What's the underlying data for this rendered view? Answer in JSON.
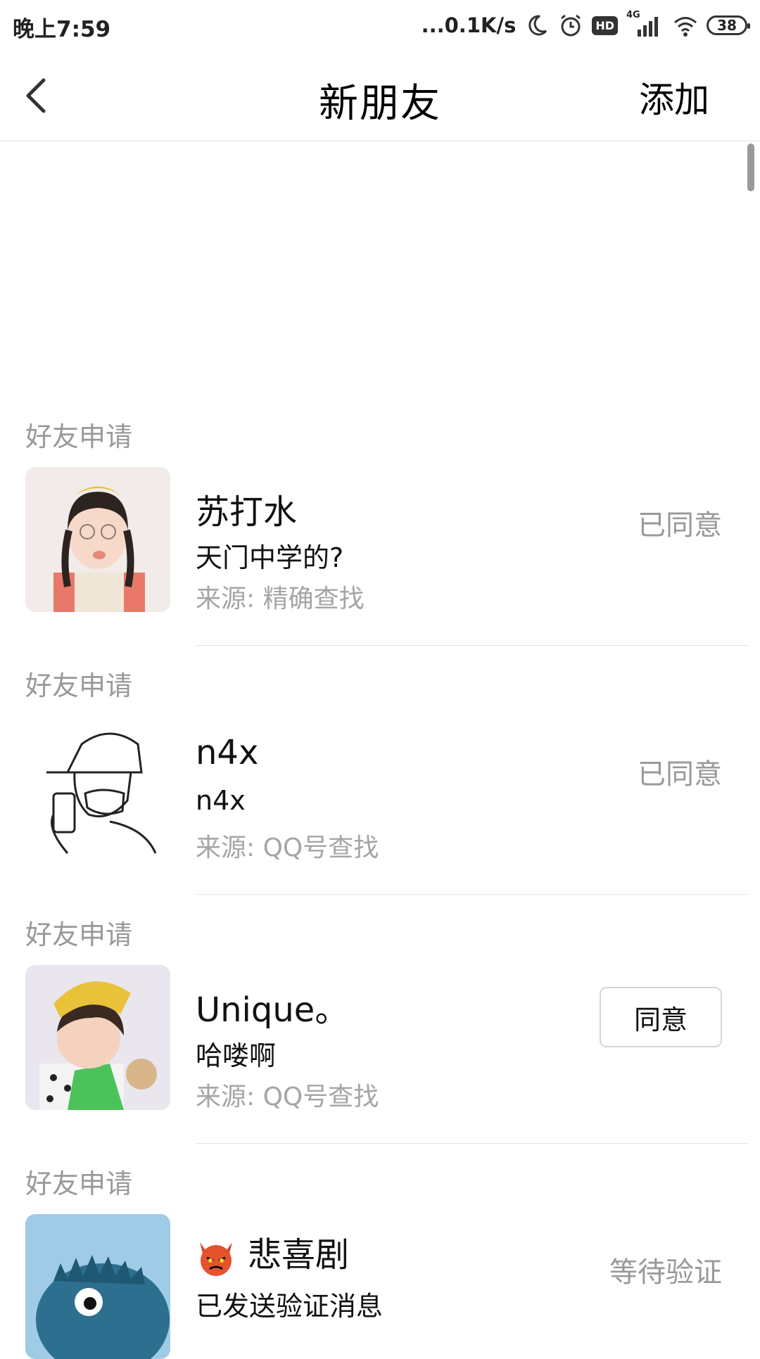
{
  "status_bar": {
    "time": "晚上7:59",
    "net_speed": "...0.1K/s",
    "hd": "HD",
    "network": "4G",
    "battery": "38"
  },
  "nav": {
    "title": "新朋友",
    "add_label": "添加"
  },
  "requests": [
    {
      "section": "好友申请",
      "name": "苏打水",
      "message": "天门中学的?",
      "source": "来源: 精确查找",
      "status": "已同意"
    },
    {
      "section": "好友申请",
      "name": "n4x",
      "message": "n4x",
      "source": "来源: QQ号查找",
      "status": "已同意"
    },
    {
      "section": "好友申请",
      "name": "Unique。",
      "message": "哈喽啊",
      "source": "来源: QQ号查找",
      "action": "同意"
    },
    {
      "section": "好友申请",
      "name": "悲喜剧",
      "message": "已发送验证消息",
      "status": "等待验证"
    }
  ]
}
